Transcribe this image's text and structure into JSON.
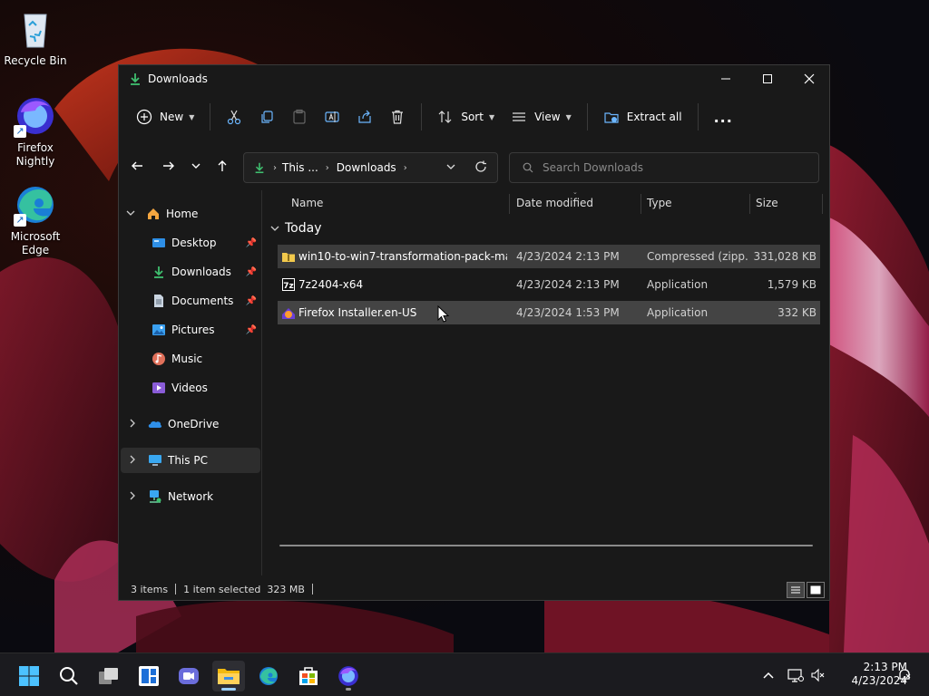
{
  "desktop": {
    "icons": [
      {
        "label": "Recycle Bin"
      },
      {
        "label": "Firefox Nightly"
      },
      {
        "label": "Microsoft Edge"
      }
    ]
  },
  "window": {
    "title": "Downloads",
    "toolbar": {
      "new_label": "New",
      "sort_label": "Sort",
      "view_label": "View",
      "extract_label": "Extract all",
      "more_label": "..."
    },
    "address": {
      "crumbs": [
        "This ...",
        "Downloads"
      ]
    },
    "search": {
      "placeholder": "Search Downloads"
    },
    "nav": {
      "home": "Home",
      "desktop": "Desktop",
      "downloads": "Downloads",
      "documents": "Documents",
      "pictures": "Pictures",
      "music": "Music",
      "videos": "Videos",
      "onedrive": "OneDrive",
      "thispc": "This PC",
      "network": "Network"
    },
    "columns": {
      "name": "Name",
      "date": "Date modified",
      "type": "Type",
      "size": "Size"
    },
    "group": "Today",
    "files": [
      {
        "name": "win10-to-win7-transformation-pack-ma...",
        "date": "4/23/2024 2:13 PM",
        "type": "Compressed (zipp...",
        "size": "331,028 KB"
      },
      {
        "name": "7z2404-x64",
        "date": "4/23/2024 2:13 PM",
        "type": "Application",
        "size": "1,579 KB"
      },
      {
        "name": "Firefox Installer.en-US",
        "date": "4/23/2024 1:53 PM",
        "type": "Application",
        "size": "332 KB"
      }
    ],
    "status": {
      "items": "3 items",
      "selected": "1 item selected  323 MB"
    }
  },
  "taskbar": {
    "time": "2:13 PM",
    "date": "4/23/2024"
  },
  "colors": {
    "accent": "#4cc2ff",
    "download_green": "#3fbf6f",
    "window_bg": "#191919",
    "selection": "#444444"
  }
}
